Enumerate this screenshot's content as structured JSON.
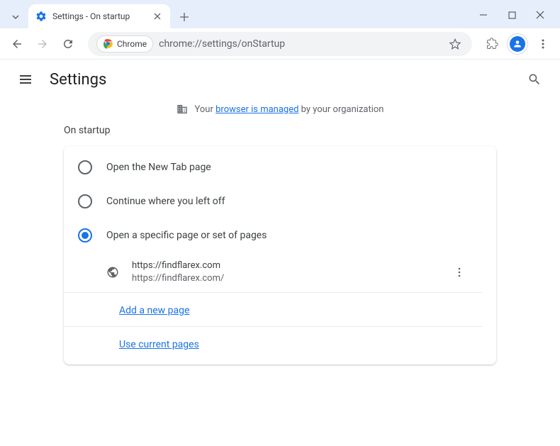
{
  "window": {
    "tab_title": "Settings - On startup"
  },
  "toolbar": {
    "chip_label": "Chrome",
    "url": "chrome://settings/onStartup"
  },
  "header": {
    "title": "Settings"
  },
  "banner": {
    "prefix": "Your ",
    "link_text": "browser is managed",
    "suffix": " by your organization"
  },
  "section": {
    "title": "On startup",
    "options": [
      {
        "label": "Open the New Tab page",
        "selected": false
      },
      {
        "label": "Continue where you left off",
        "selected": false
      },
      {
        "label": "Open a specific page or set of pages",
        "selected": true
      }
    ],
    "pages": [
      {
        "title": "https://findflarex.com",
        "url": "https://findflarex.com/"
      }
    ],
    "add_link": "Add a new page",
    "use_current_link": "Use current pages"
  }
}
